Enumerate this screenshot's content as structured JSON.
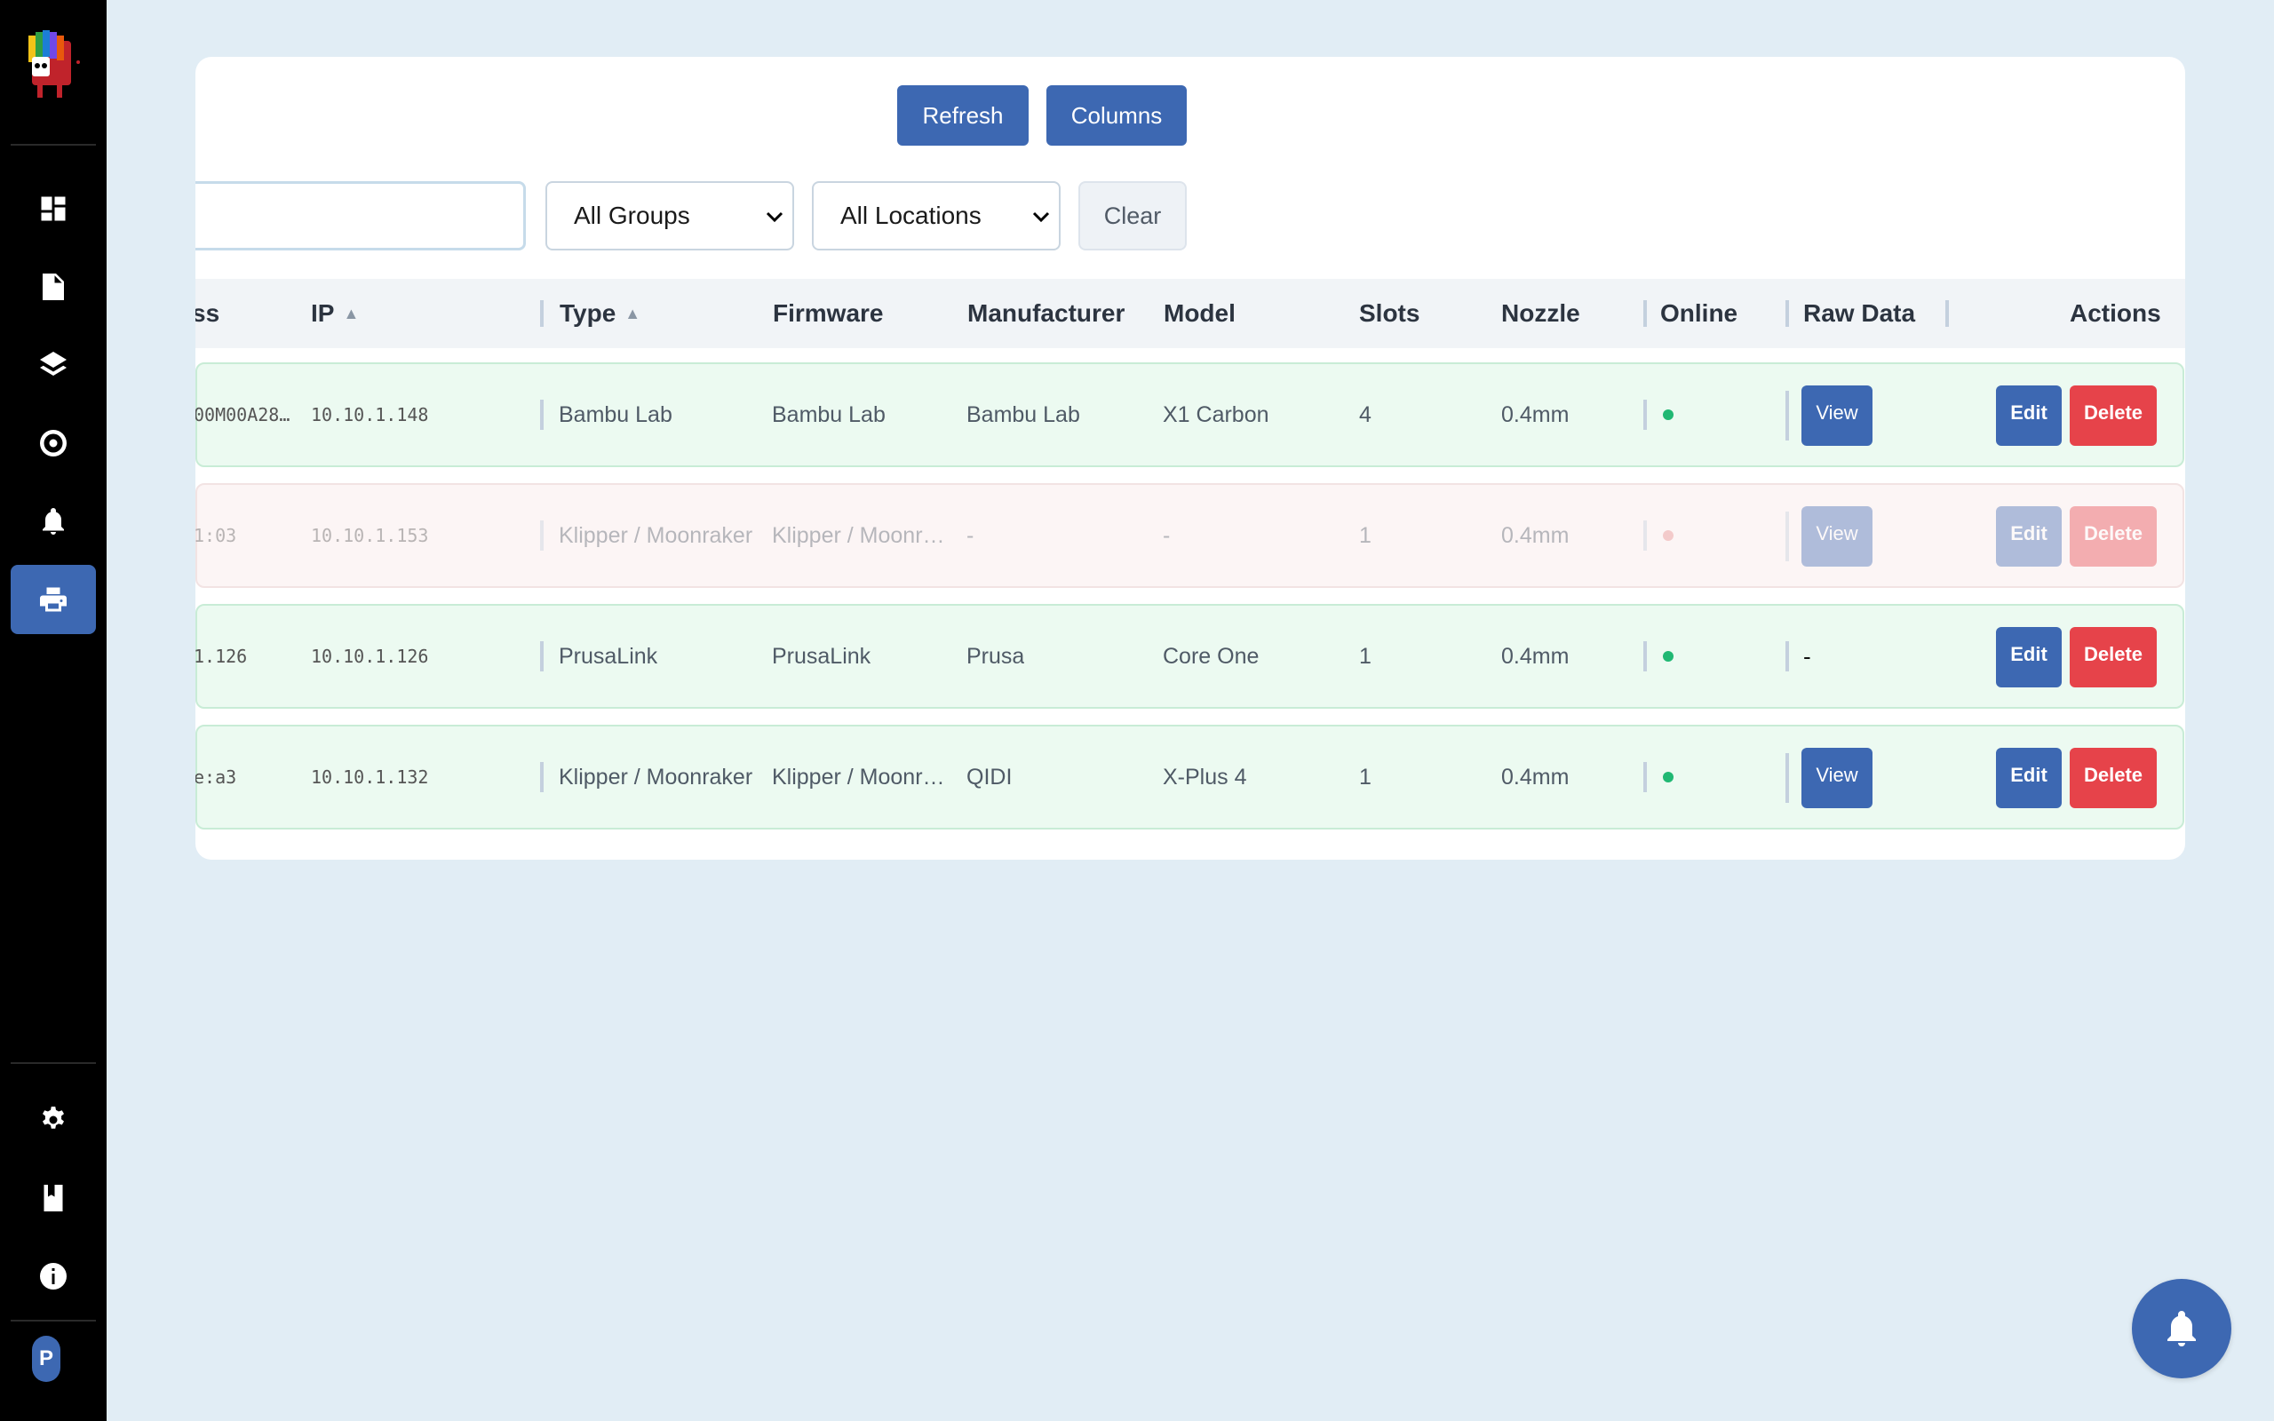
{
  "sidebar": {
    "logo_name": "app-logo",
    "nav": [
      {
        "name": "dashboard",
        "icon": "dashboard-icon"
      },
      {
        "name": "files",
        "icon": "file-icon"
      },
      {
        "name": "layers",
        "icon": "layers-icon"
      },
      {
        "name": "spools",
        "icon": "spool-icon"
      },
      {
        "name": "notifications",
        "icon": "bell-icon"
      },
      {
        "name": "printers",
        "icon": "printer-icon",
        "active": true
      }
    ],
    "bottom": [
      {
        "name": "settings",
        "icon": "gear-icon"
      },
      {
        "name": "docs",
        "icon": "book-icon"
      },
      {
        "name": "about",
        "icon": "info-icon"
      }
    ],
    "avatar_initial": "P"
  },
  "toolbar": {
    "refresh_label": "Refresh",
    "columns_label": "Columns"
  },
  "filters": {
    "search_value": "",
    "group_selected": "All Groups",
    "location_selected": "All Locations",
    "clear_label": "Clear"
  },
  "table": {
    "headers": {
      "address": "ss",
      "ip": "IP",
      "ip_sort": "▲",
      "type": "Type",
      "type_sort": "▲",
      "firmware": "Firmware",
      "manufacturer": "Manufacturer",
      "model": "Model",
      "slots": "Slots",
      "nozzle": "Nozzle",
      "online": "Online",
      "raw_data": "Raw Data",
      "actions": "Actions"
    },
    "rows": [
      {
        "address": "00M00A280…",
        "ip": "10.10.1.148",
        "type": "Bambu Lab",
        "firmware": "Bambu Lab",
        "manufacturer": "Bambu Lab",
        "model": "X1 Carbon",
        "slots": "4",
        "nozzle": "0.4mm",
        "online": true,
        "raw": "View",
        "edit": "Edit",
        "delete": "Delete"
      },
      {
        "address": "1:03",
        "ip": "10.10.1.153",
        "type": "Klipper / Moonraker",
        "firmware": "Klipper / Moonraker",
        "manufacturer": "-",
        "model": "-",
        "slots": "1",
        "nozzle": "0.4mm",
        "online": false,
        "raw": "View",
        "edit": "Edit",
        "delete": "Delete"
      },
      {
        "address": "1.126",
        "ip": "10.10.1.126",
        "type": "PrusaLink",
        "firmware": "PrusaLink",
        "manufacturer": "Prusa",
        "model": "Core One",
        "slots": "1",
        "nozzle": "0.4mm",
        "online": true,
        "raw": "-",
        "edit": "Edit",
        "delete": "Delete"
      },
      {
        "address": "e:a3",
        "ip": "10.10.1.132",
        "type": "Klipper / Moonraker",
        "firmware": "Klipper / Moonraker",
        "manufacturer": "QIDI",
        "model": "X-Plus 4",
        "slots": "1",
        "nozzle": "0.4mm",
        "online": true,
        "raw": "View",
        "edit": "Edit",
        "delete": "Delete"
      }
    ]
  },
  "colors": {
    "primary": "#3d68b2",
    "danger": "#e6434a",
    "online": "#20b873",
    "offline": "#e88b8b",
    "background": "#e1edf5"
  }
}
